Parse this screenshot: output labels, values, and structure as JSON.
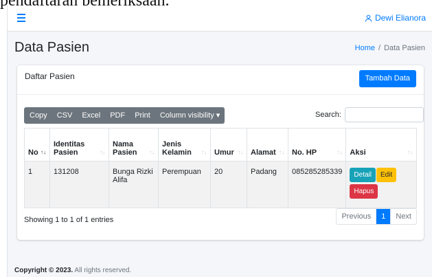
{
  "header": {
    "caption": "pendaftaran pemeriksaan.",
    "user_name": "Dewi Elianora"
  },
  "page": {
    "title": "Data Pasien",
    "breadcrumb_home": "Home",
    "breadcrumb_current": "Data Pasien"
  },
  "card": {
    "title": "Daftar Pasien",
    "add_button": "Tambah Data"
  },
  "toolbar": {
    "buttons": [
      "Copy",
      "CSV",
      "Excel",
      "PDF",
      "Print",
      "Column visibility ▾"
    ],
    "search_label": "Search:"
  },
  "table": {
    "columns": [
      "No",
      "Identitas Pasien",
      "Nama Pasien",
      "Jenis Kelamin",
      "Umur",
      "Alamat",
      "No. HP",
      "Aksi"
    ],
    "rows": [
      {
        "no": "1",
        "identitas": "131208",
        "nama": "Bunga Rizki Alifa",
        "jenis_kelamin": "Perempuan",
        "umur": "20",
        "alamat": "Padang",
        "no_hp": "085285285339"
      }
    ],
    "actions": {
      "detail": "Detail",
      "edit": "Edit",
      "hapus": "Hapus"
    }
  },
  "info": "Showing 1 to 1 of 1 entries",
  "pagination": {
    "previous": "Previous",
    "current": "1",
    "next": "Next"
  },
  "footer": {
    "copyright": "Copyright © 2023.",
    "rights": "All rights reserved."
  },
  "colors": {
    "primary": "#007bff",
    "info": "#17a2b8",
    "warning": "#ffc107",
    "danger": "#dc3545",
    "secondary": "#6c757d"
  },
  "icons": {
    "menu": "hamburger-icon",
    "user": "user-icon",
    "sort": "sort-icon"
  }
}
